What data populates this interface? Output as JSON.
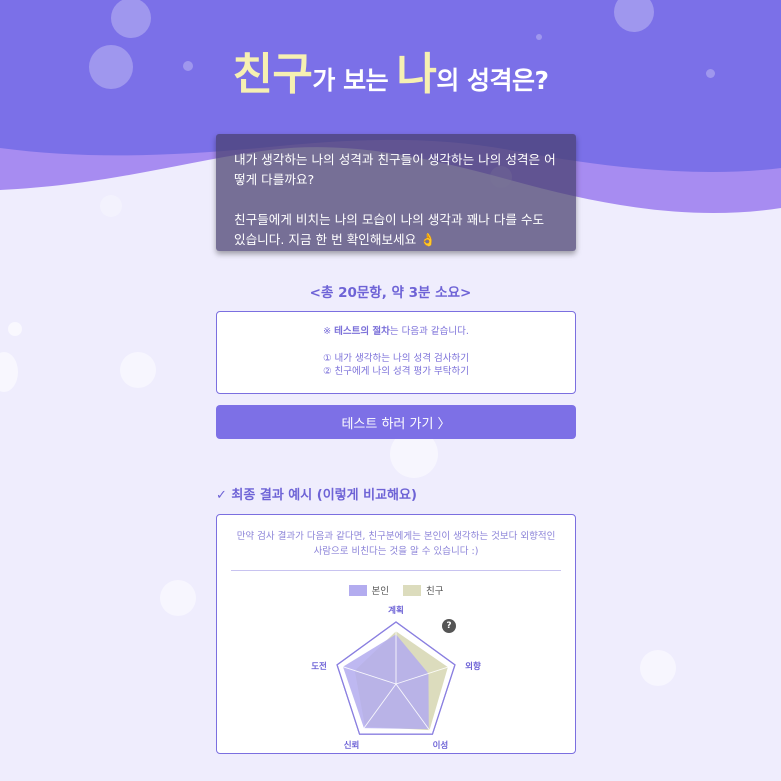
{
  "hero": {
    "title_parts": [
      "친구",
      "가 보는 ",
      "나",
      "의 성격은?"
    ]
  },
  "intro": {
    "line1": "내가 생각하는 나의 성격과 친구들이 생각하는 나의 성격은 어떻게 다를까요?",
    "line2": "친구들에게 비치는 나의 모습이 나의 생각과 꽤나 다를 수도 있습니다. 지금 한 번 확인해보세요 👌"
  },
  "count_text": "<총 20문항, 약 3분 소요>",
  "steps": {
    "heading_prefix": "※ ",
    "heading_bold": "테스트의 절차",
    "heading_suffix": "는 다음과 같습니다.",
    "step1": "① 내가 생각하는 나의 성격 검사하기",
    "step2": "② 친구에게 나의 성격 평가 부탁하기"
  },
  "go_button": "테스트 하러 가기 〉",
  "result": {
    "heading": "✓ 최종 결과 예시 (이렇게 비교해요)",
    "description": "만약 검사 결과가 다음과 같다면, 친구분에게는 본인이 생각하는 것보다 외향적인 사람으로 비친다는 것을 알 수 있습니다 :)",
    "help_icon": "?"
  },
  "colors": {
    "primary": "#7d70e6",
    "hero_top": "#7b70e8",
    "wave": "#a78cf1",
    "highlight": "#f6f0b2",
    "self_fill": "#b3acef",
    "friend_fill": "#dcdcbd"
  },
  "chart_data": {
    "type": "radar",
    "axes": [
      "계획",
      "외향",
      "이성",
      "신뢰",
      "도전"
    ],
    "series": [
      {
        "name": "본인",
        "values": [
          0.8,
          0.55,
          0.9,
          0.88,
          0.9
        ]
      },
      {
        "name": "친구",
        "values": [
          0.85,
          0.88,
          0.92,
          0.85,
          0.7
        ]
      }
    ],
    "legend": [
      "본인",
      "친구"
    ],
    "range": [
      0,
      1
    ],
    "rings": 1
  }
}
